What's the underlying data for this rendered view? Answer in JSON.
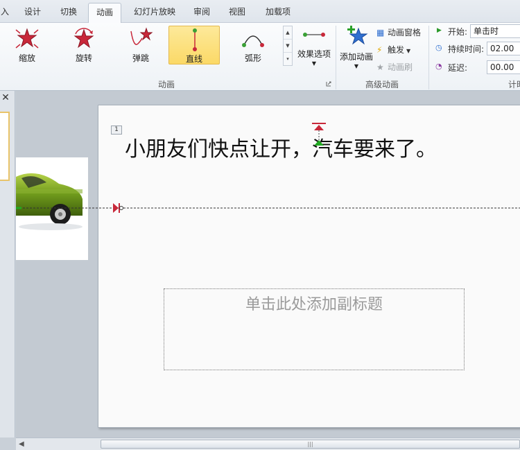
{
  "tabs": [
    {
      "label": "入"
    },
    {
      "label": "设计"
    },
    {
      "label": "切换"
    },
    {
      "label": "动画"
    },
    {
      "label": "幻灯片放映"
    },
    {
      "label": "审阅"
    },
    {
      "label": "视图"
    },
    {
      "label": "加载项"
    }
  ],
  "ribbon": {
    "gallery": [
      {
        "label": "缩放",
        "icon": "zoom-star-icon"
      },
      {
        "label": "旋转",
        "icon": "spin-star-icon"
      },
      {
        "label": "弹跳",
        "icon": "bounce-star-icon"
      },
      {
        "label": "直线",
        "icon": "line-path-icon",
        "selected": true
      },
      {
        "label": "弧形",
        "icon": "arc-path-icon"
      }
    ],
    "effect_options_label": "效果选项",
    "animation_group_label": "动画",
    "add_animation_label": "添加动画",
    "animation_pane_label": "动画窗格",
    "trigger_label": "触发",
    "animation_painter_label": "动画刷",
    "advanced_group_label": "高级动画",
    "timing": {
      "start_label": "开始:",
      "start_value": "单击时",
      "duration_label": "持续时间:",
      "duration_value": "02.00",
      "delay_label": "延迟:",
      "delay_value": "00.00",
      "group_label": "计时"
    }
  },
  "left_panel": {
    "close_glyph": "✕"
  },
  "slide": {
    "animation_tag": "1",
    "title": "小朋友们快点让开，汽车要来了。",
    "subtitle_placeholder": "单击此处添加副标题"
  },
  "colors": {
    "selected_fill": "#fbd967",
    "motion_path": "#333333",
    "start_marker": "#22aa22",
    "end_marker": "#cc2222"
  }
}
